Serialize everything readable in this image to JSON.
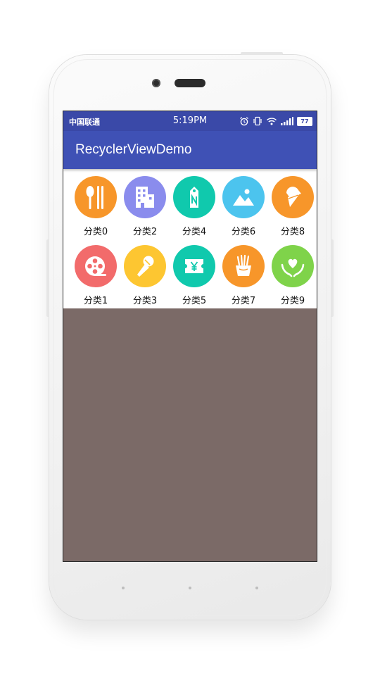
{
  "statusbar": {
    "carrier": "中国联通",
    "time": "5:19PM",
    "battery": "77"
  },
  "toolbar": {
    "title": "RecyclerViewDemo"
  },
  "categories": [
    {
      "label": "分类0",
      "icon": "utensils-icon",
      "color": "#f7962a"
    },
    {
      "label": "分类1",
      "icon": "film-reel-icon",
      "color": "#f26b6b"
    },
    {
      "label": "分类2",
      "icon": "building-icon",
      "color": "#8a8ced"
    },
    {
      "label": "分类3",
      "icon": "microphone-icon",
      "color": "#fdc631"
    },
    {
      "label": "分类4",
      "icon": "tag-icon",
      "color": "#10c9ad"
    },
    {
      "label": "分类5",
      "icon": "ticket-icon",
      "color": "#10c9ad"
    },
    {
      "label": "分类6",
      "icon": "landscape-icon",
      "color": "#4cc4ee"
    },
    {
      "label": "分类7",
      "icon": "fries-icon",
      "color": "#f7962a"
    },
    {
      "label": "分类8",
      "icon": "ice-cream-icon",
      "color": "#f7962a"
    },
    {
      "label": "分类9",
      "icon": "heart-hands-icon",
      "color": "#7fd34a"
    }
  ]
}
